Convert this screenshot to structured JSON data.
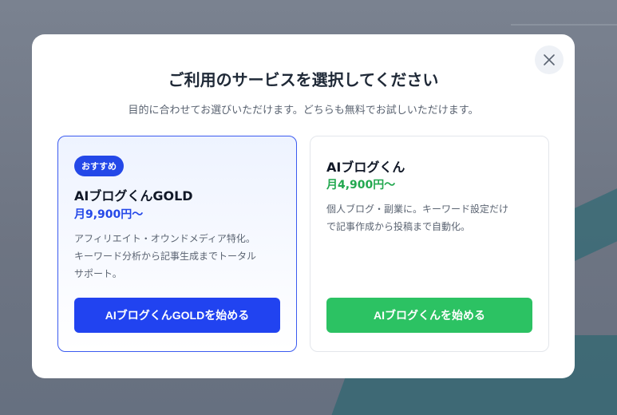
{
  "modal": {
    "title": "ご利用のサービスを選択してください",
    "subtitle": "目的に合わせてお選びいただけます。どちらも無料でお試しいただけます。",
    "close_icon": "close-icon"
  },
  "plans": {
    "gold": {
      "badge": "おすすめ",
      "name": "AIブログくんGOLD",
      "price": "月9,900円〜",
      "desc_line1": "アフィリエイト・オウンドメディア特化。",
      "desc_line2": "キーワード分析から記事生成までトータル",
      "desc_line3": "サポート。",
      "cta": "AIブログくんGOLDを始める",
      "accent": "#2448e8"
    },
    "standard": {
      "name": "AIブログくん",
      "price": "月4,900円〜",
      "desc_line1": "個人ブログ・副業に。キーワード設定だけ",
      "desc_line2": "で記事作成から投稿まで自動化。",
      "cta": "AIブログくんを始める",
      "accent": "#2cc263"
    }
  }
}
